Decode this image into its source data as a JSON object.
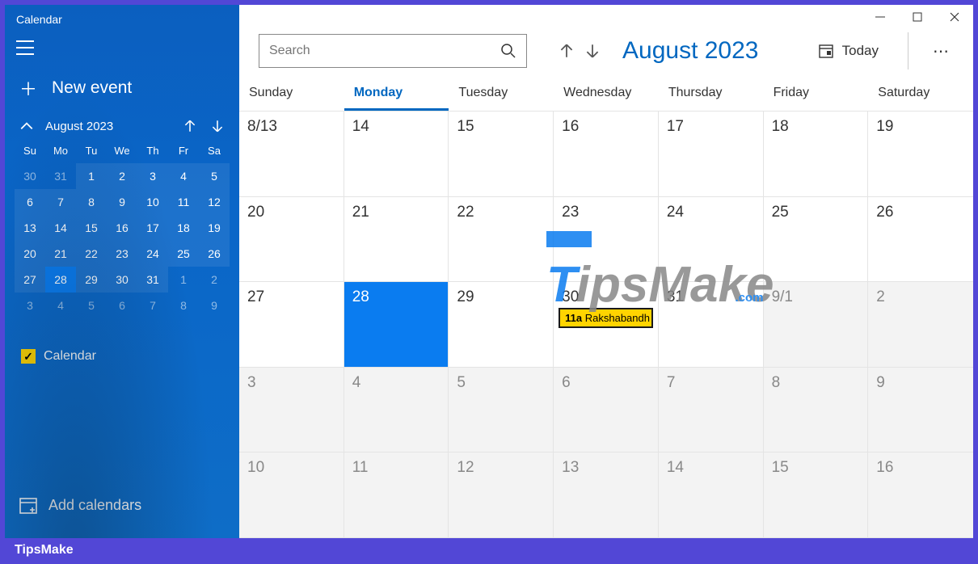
{
  "app": {
    "title": "Calendar"
  },
  "sidebar": {
    "new_event": "New event",
    "mini": {
      "month": "August 2023",
      "dows": [
        "Su",
        "Mo",
        "Tu",
        "We",
        "Th",
        "Fr",
        "Sa"
      ],
      "days": [
        {
          "n": "30",
          "dim": true
        },
        {
          "n": "31",
          "dim": true
        },
        {
          "n": "1",
          "hl": true
        },
        {
          "n": "2",
          "hl": true
        },
        {
          "n": "3",
          "hl": true
        },
        {
          "n": "4",
          "hl": true
        },
        {
          "n": "5",
          "hl": true
        },
        {
          "n": "6",
          "hl": true
        },
        {
          "n": "7",
          "hl": true
        },
        {
          "n": "8",
          "hl": true
        },
        {
          "n": "9",
          "hl": true
        },
        {
          "n": "10",
          "hl": true
        },
        {
          "n": "11",
          "hl": true
        },
        {
          "n": "12",
          "hl": true
        },
        {
          "n": "13",
          "hl": true
        },
        {
          "n": "14",
          "hl": true
        },
        {
          "n": "15",
          "hl": true
        },
        {
          "n": "16",
          "hl": true
        },
        {
          "n": "17",
          "hl": true
        },
        {
          "n": "18",
          "hl": true
        },
        {
          "n": "19",
          "hl": true
        },
        {
          "n": "20",
          "hl": true
        },
        {
          "n": "21",
          "hl": true
        },
        {
          "n": "22",
          "hl": true
        },
        {
          "n": "23",
          "hl": true
        },
        {
          "n": "24",
          "hl": true
        },
        {
          "n": "25",
          "hl": true
        },
        {
          "n": "26",
          "hl": true
        },
        {
          "n": "27",
          "hl": true
        },
        {
          "n": "28",
          "today": true
        },
        {
          "n": "29",
          "hl": true
        },
        {
          "n": "30",
          "hl": true
        },
        {
          "n": "31",
          "hl": true
        },
        {
          "n": "1",
          "dim": true
        },
        {
          "n": "2",
          "dim": true
        },
        {
          "n": "3",
          "dim": true
        },
        {
          "n": "4",
          "dim": true
        },
        {
          "n": "5",
          "dim": true
        },
        {
          "n": "6",
          "dim": true
        },
        {
          "n": "7",
          "dim": true
        },
        {
          "n": "8",
          "dim": true
        },
        {
          "n": "9",
          "dim": true
        }
      ]
    },
    "calendar_toggle": "Calendar",
    "add_calendars": "Add calendars"
  },
  "toolbar": {
    "search_placeholder": "Search",
    "month_title": "August 2023",
    "today": "Today"
  },
  "calendar": {
    "dows": [
      "Sunday",
      "Monday",
      "Tuesday",
      "Wednesday",
      "Thursday",
      "Friday",
      "Saturday"
    ],
    "active_dow_index": 1,
    "cells": [
      {
        "label": "8/13"
      },
      {
        "label": "14"
      },
      {
        "label": "15"
      },
      {
        "label": "16"
      },
      {
        "label": "17"
      },
      {
        "label": "18"
      },
      {
        "label": "19"
      },
      {
        "label": "20"
      },
      {
        "label": "21"
      },
      {
        "label": "22"
      },
      {
        "label": "23"
      },
      {
        "label": "24"
      },
      {
        "label": "25"
      },
      {
        "label": "26"
      },
      {
        "label": "27"
      },
      {
        "label": "28",
        "today": true
      },
      {
        "label": "29"
      },
      {
        "label": "30",
        "event": {
          "time": "11a",
          "title": "Rakshabandh"
        }
      },
      {
        "label": "31"
      },
      {
        "label": "9/1",
        "out": true
      },
      {
        "label": "2",
        "out": true
      },
      {
        "label": "3",
        "out": true
      },
      {
        "label": "4",
        "out": true
      },
      {
        "label": "5",
        "out": true
      },
      {
        "label": "6",
        "out": true
      },
      {
        "label": "7",
        "out": true
      },
      {
        "label": "8",
        "out": true
      },
      {
        "label": "9",
        "out": true
      },
      {
        "label": "10",
        "out": true
      },
      {
        "label": "11",
        "out": true
      },
      {
        "label": "12",
        "out": true
      },
      {
        "label": "13",
        "out": true
      },
      {
        "label": "14",
        "out": true
      },
      {
        "label": "15",
        "out": true
      },
      {
        "label": "16",
        "out": true
      }
    ]
  },
  "footer": "TipsMake",
  "watermark": {
    "brand1": "T",
    "brand2": "ipsMake",
    "suffix": ".com"
  }
}
